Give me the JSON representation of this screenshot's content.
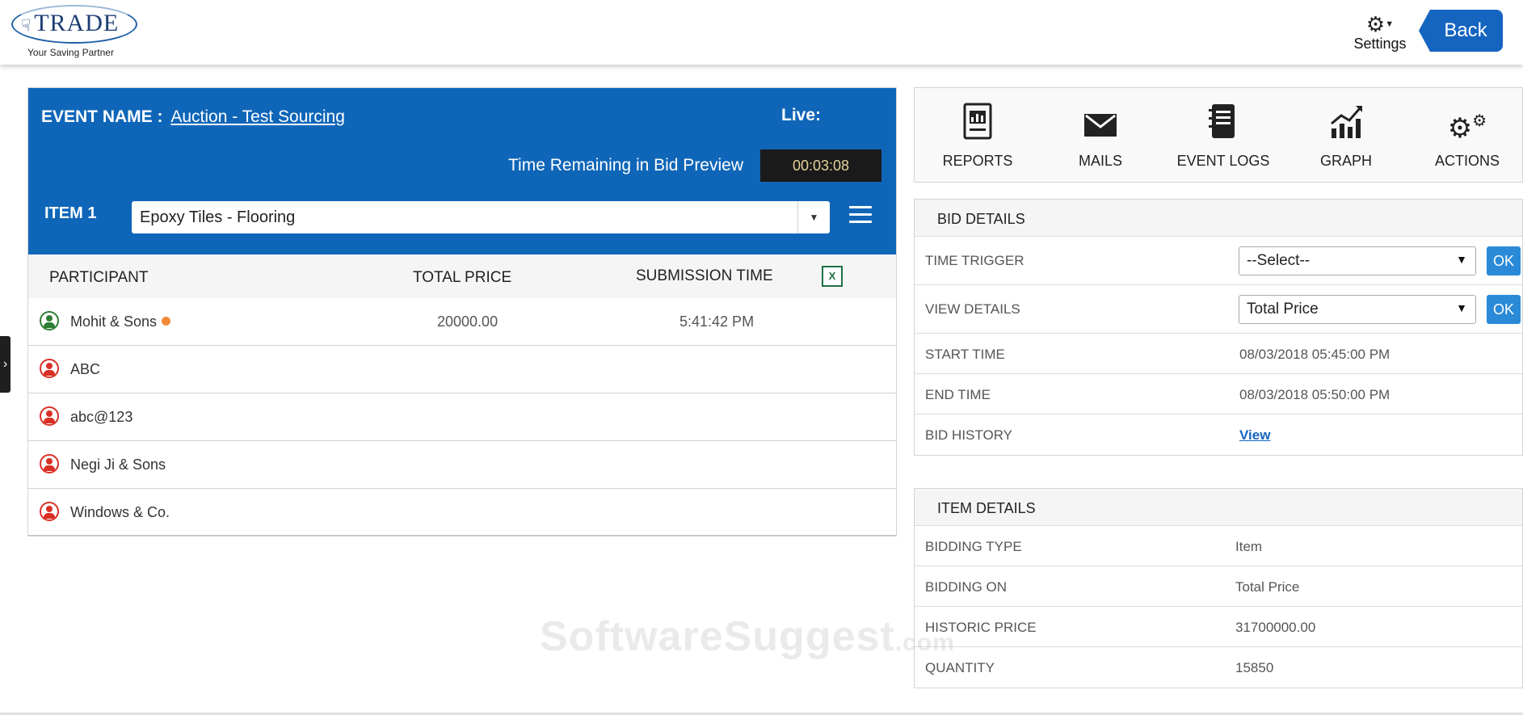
{
  "header": {
    "brand": "TRADE",
    "tagline": "Your Saving Partner",
    "settings_label": "Settings",
    "back_label": "Back"
  },
  "event": {
    "name_label": "EVENT NAME :",
    "name": "Auction - Test Sourcing",
    "live_label": "Live:",
    "remaining_label": "Time Remaining in Bid Preview",
    "timer": "00:03:08",
    "item_label": "ITEM 1",
    "item_selected": "Epoxy Tiles - Flooring"
  },
  "table": {
    "headers": {
      "participant": "PARTICIPANT",
      "total_price": "TOTAL PRICE",
      "submission_time": "SUBMISSION TIME"
    },
    "excel_icon_text": "X",
    "rows": [
      {
        "name": "Mohit & Sons",
        "price": "20000.00",
        "time": "5:41:42 PM"
      },
      {
        "name": "ABC",
        "price": "",
        "time": ""
      },
      {
        "name": "abc@123",
        "price": "",
        "time": ""
      },
      {
        "name": "Negi Ji & Sons",
        "price": "",
        "time": ""
      },
      {
        "name": "Windows & Co.",
        "price": "",
        "time": ""
      }
    ]
  },
  "toolbar": {
    "items": [
      {
        "label": "REPORTS",
        "icon": "reports-icon"
      },
      {
        "label": "MAILS",
        "icon": "mail-icon"
      },
      {
        "label": "EVENT LOGS",
        "icon": "event-logs-icon"
      },
      {
        "label": "GRAPH",
        "icon": "graph-icon"
      },
      {
        "label": "ACTIONS",
        "icon": "gears-icon"
      }
    ]
  },
  "bid_details": {
    "title": "BID DETAILS",
    "time_trigger_label": "TIME TRIGGER",
    "time_trigger_value": "--Select--",
    "view_details_label": "VIEW DETAILS",
    "view_details_value": "Total Price",
    "ok_label": "OK",
    "start_time_label": "START TIME",
    "start_time": "08/03/2018 05:45:00 PM",
    "end_time_label": "END TIME",
    "end_time": "08/03/2018 05:50:00 PM",
    "bid_history_label": "BID HISTORY",
    "bid_history_link": "View"
  },
  "item_details": {
    "title": "ITEM DETAILS",
    "rows": [
      {
        "label": "BIDDING TYPE",
        "value": "Item"
      },
      {
        "label": "BIDDING ON",
        "value": "Total Price"
      },
      {
        "label": "HISTORIC PRICE",
        "value": "31700000.00"
      },
      {
        "label": "QUANTITY",
        "value": "15850"
      }
    ]
  },
  "watermark": {
    "main": "SoftwareSuggest",
    "suffix": ".com"
  },
  "colors": {
    "primary": "#0f66b8",
    "button": "#1565c0",
    "ok": "#2a8ad8",
    "timer_bg": "#1a1a1a",
    "offline": "#d93025",
    "online": "#2e7d32",
    "status_dot": "#f08a3a"
  }
}
